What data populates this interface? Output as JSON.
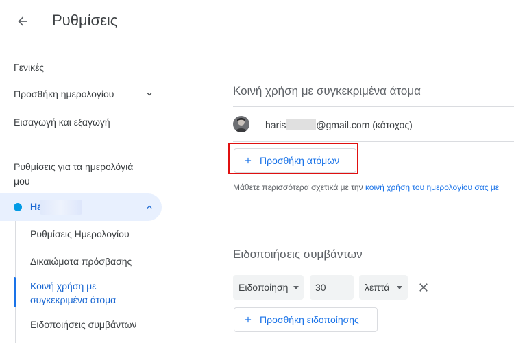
{
  "header": {
    "title": "Ρυθμίσεις",
    "back_icon": "arrow-back-icon"
  },
  "sidebar": {
    "general": "Γενικές",
    "add_calendar": "Προσθήκη ημερολογίου",
    "import_export": "Εισαγωγή και εξαγωγή",
    "my_calendars_heading": "Ρυθμίσεις για τα ημερολόγιά μου",
    "calendar": {
      "name": "Ha",
      "color": "#039be5"
    },
    "subitems": [
      "Ρυθμίσεις Ημερολογίου",
      "Δικαιώματα πρόσβασης",
      "Κοινή χρήση με συγκεκριμένα άτομα",
      "Ειδοποιήσεις συμβάντων"
    ],
    "active_color": "#1967d2"
  },
  "sharing": {
    "title": "Κοινή χρήση με συγκεκριμένα άτομα",
    "owner_prefix": "haris",
    "owner_suffix": "@gmail.com (κάτοχος)",
    "add_people": "Προσθήκη ατόμων",
    "help_prefix": "Μάθετε περισσότερα σχετικά με την ",
    "help_link": "κοινή χρήση του ημερολογίου σας με"
  },
  "notifications": {
    "title": "Ειδοποιήσεις συμβάντων",
    "type_value": "Ειδοποίηση",
    "amount_value": "30",
    "unit_value": "λεπτά",
    "add_notification": "Προσθήκη ειδοποίησης"
  },
  "colors": {
    "accent": "#1a73e8",
    "highlight": "#e01010"
  }
}
